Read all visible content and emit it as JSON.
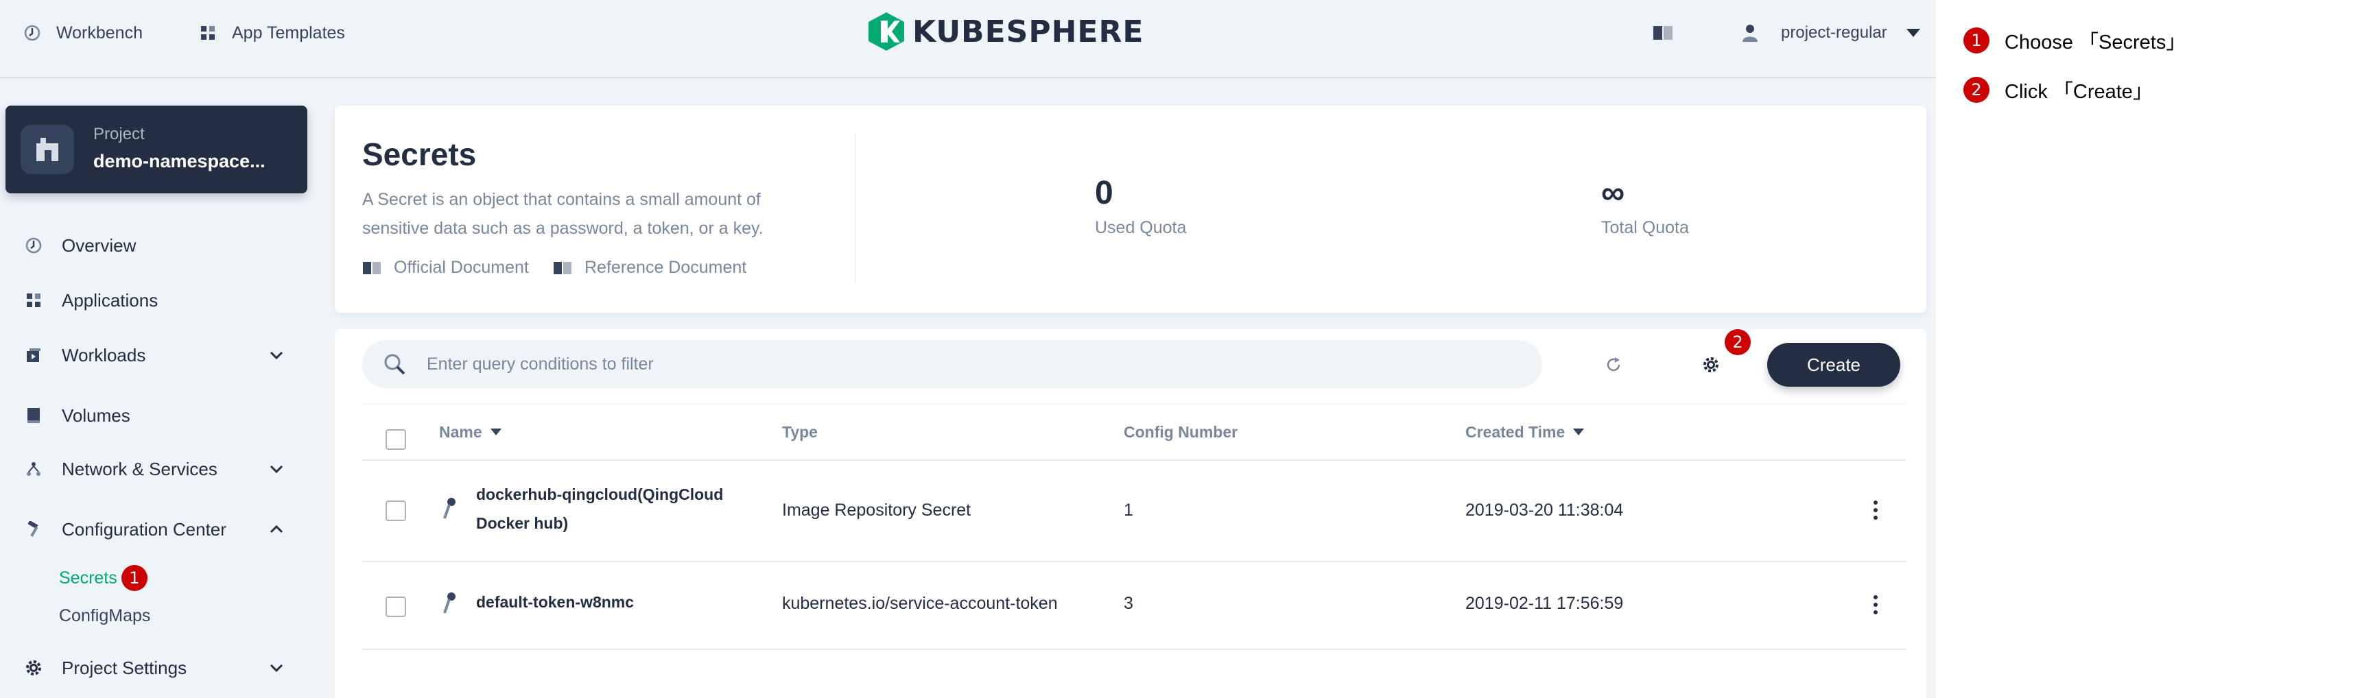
{
  "topbar": {
    "workbench": "Workbench",
    "app_templates": "App Templates",
    "logo_text": "KUBESPHERE",
    "user": "project-regular"
  },
  "sidebar": {
    "project_label": "Project",
    "project_name": "demo-namespace...",
    "items": [
      {
        "label": "Overview"
      },
      {
        "label": "Applications"
      },
      {
        "label": "Workloads"
      },
      {
        "label": "Volumes"
      },
      {
        "label": "Network & Services"
      },
      {
        "label": "Configuration Center"
      },
      {
        "label": "Project Settings"
      }
    ],
    "sub_items": [
      {
        "label": "Secrets"
      },
      {
        "label": "ConfigMaps"
      }
    ]
  },
  "header": {
    "title": "Secrets",
    "description": "A Secret is an object that contains a small amount of sensitive data such as a password, a token, or a key.",
    "official_doc": "Official Document",
    "reference_doc": "Reference Document",
    "used_quota_value": "0",
    "used_quota_label": "Used Quota",
    "total_quota_value": "∞",
    "total_quota_label": "Total Quota"
  },
  "toolbar": {
    "search_placeholder": "Enter query conditions to filter",
    "create_label": "Create"
  },
  "table": {
    "columns": [
      "Name",
      "Type",
      "Config Number",
      "Created Time"
    ],
    "rows": [
      {
        "name": "dockerhub-qingcloud(QingCloud Docker hub)",
        "type": "Image Repository Secret",
        "config_number": "1",
        "created": "2019-03-20 11:38:04"
      },
      {
        "name": "default-token-w8nmc",
        "type": "kubernetes.io/service-account-token",
        "config_number": "3",
        "created": "2019-02-11 17:56:59"
      }
    ]
  },
  "annotations": {
    "badge_1": "1",
    "badge_2": "2"
  },
  "steps": [
    {
      "num": "1",
      "text": "Choose 「Secrets」"
    },
    {
      "num": "2",
      "text": "Click 「Create」"
    }
  ],
  "colors": {
    "primary_dark": "#242e42",
    "background": "#eff4f9",
    "active_green": "#00aa72",
    "badge_red": "#cc0000",
    "muted_text": "#79879c"
  }
}
